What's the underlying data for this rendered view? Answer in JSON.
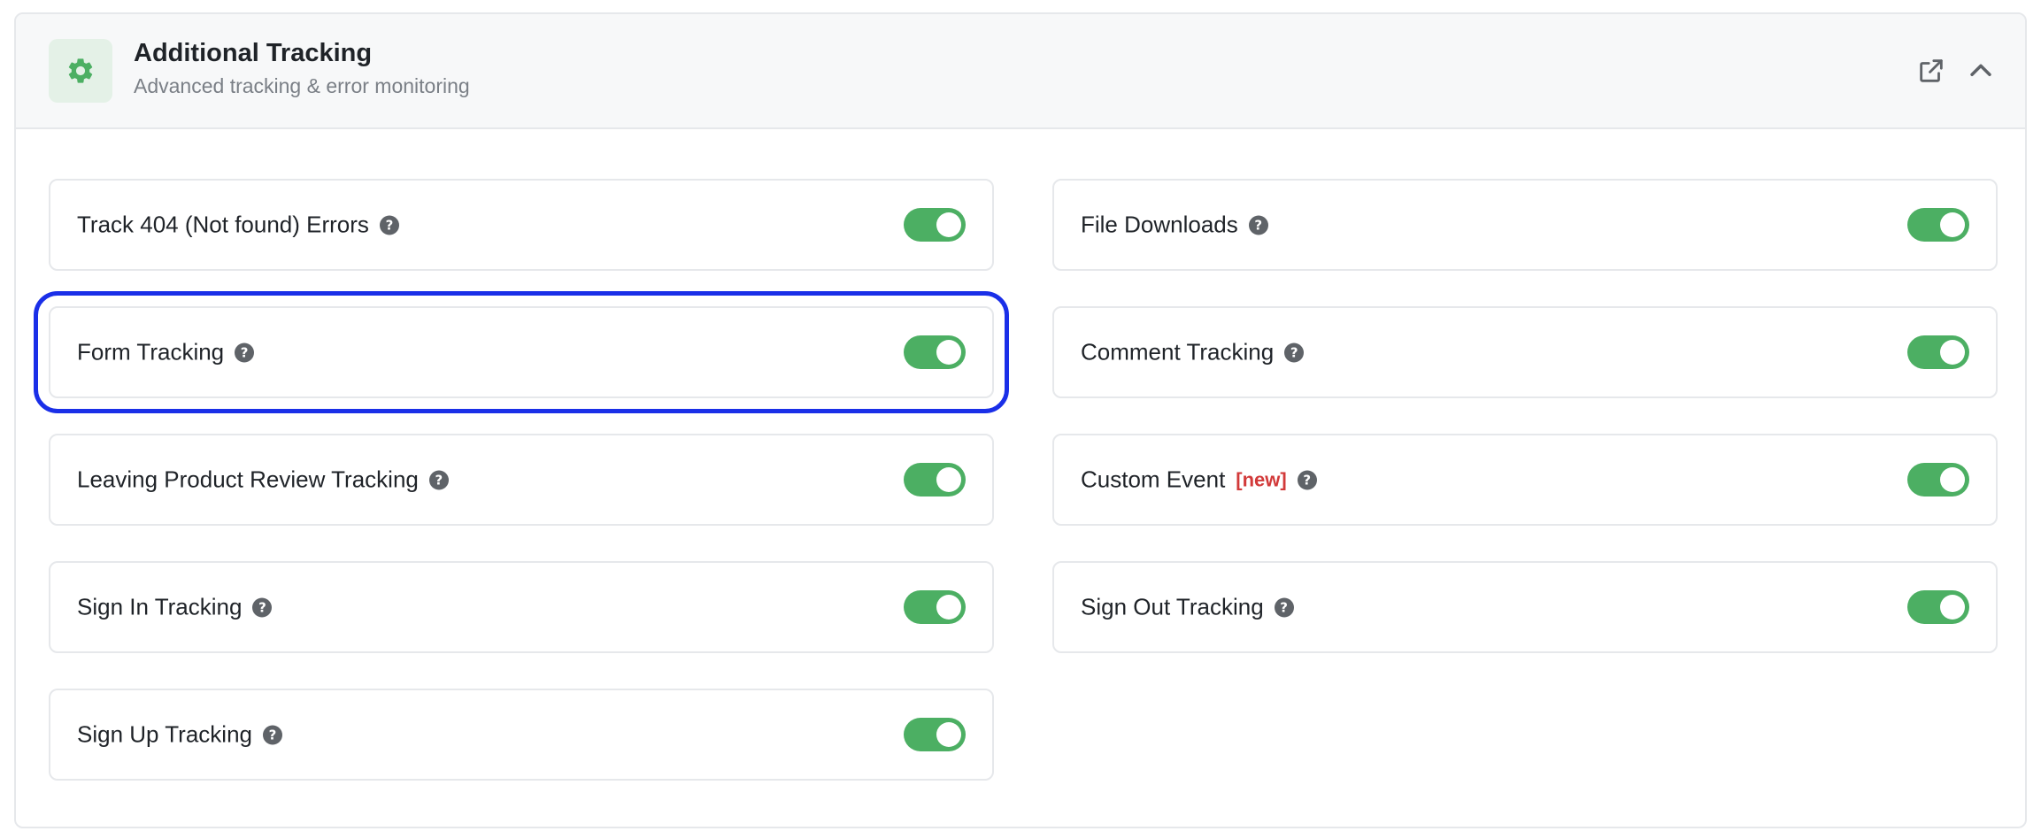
{
  "header": {
    "title": "Additional Tracking",
    "subtitle": "Advanced tracking & error monitoring",
    "icon": "gear-icon",
    "actions": [
      "external-link-icon",
      "chevron-up-icon"
    ]
  },
  "colors": {
    "toggle_on": "#4caf63",
    "header_icon_bg": "#e4f1e7",
    "highlight": "#1a2fe8",
    "new_badge": "#d23a3a"
  },
  "items": [
    {
      "label": "Track 404 (Not found) Errors",
      "enabled": true
    },
    {
      "label": "File Downloads",
      "enabled": true
    },
    {
      "label": "Form Tracking",
      "enabled": true
    },
    {
      "label": "Comment Tracking",
      "enabled": true
    },
    {
      "label": "Leaving Product Review Tracking",
      "enabled": true
    },
    {
      "label": "Custom Event",
      "badge": "[new]",
      "enabled": true
    },
    {
      "label": "Sign In Tracking",
      "enabled": true
    },
    {
      "label": "Sign Out Tracking",
      "enabled": true
    },
    {
      "label": "Sign Up Tracking",
      "enabled": true
    }
  ]
}
